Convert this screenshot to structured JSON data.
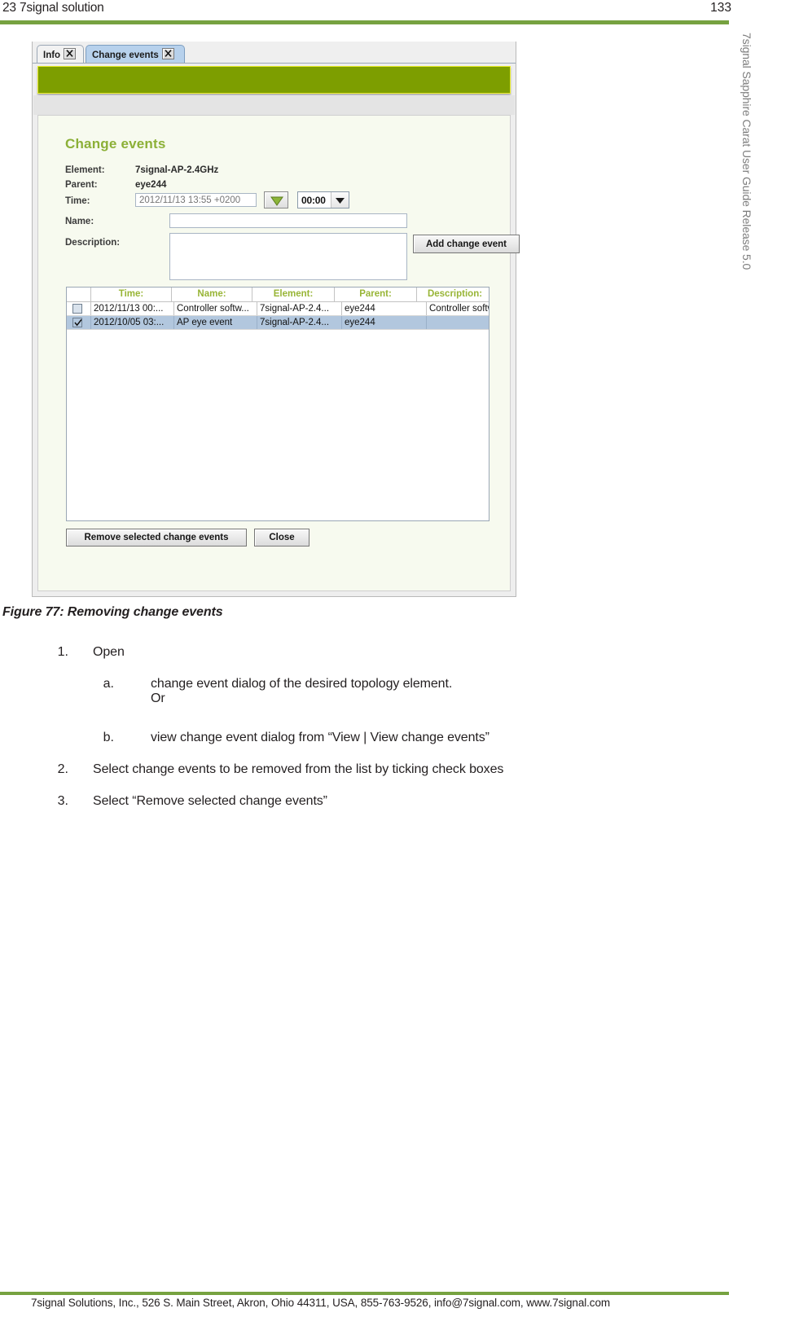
{
  "page_header": {
    "running_title": "23 7signal solution",
    "page_number": "133",
    "rule_color": "#76a240"
  },
  "side_running_title": "7signal Sapphire Carat User Guide Release 5.0",
  "figure": {
    "caption": "Figure 77: Removing change events",
    "app": {
      "tabs": [
        {
          "label": "Info",
          "close_icon": "close-icon",
          "active": false
        },
        {
          "label": "Change events",
          "close_icon": "close-icon",
          "active": true
        }
      ],
      "banner_color": "#7d9e00",
      "panel": {
        "title": "Change events",
        "fields": {
          "element_label": "Element:",
          "element_value": "7signal-AP-2.4GHz",
          "parent_label": "Parent:",
          "parent_value": "eye244",
          "time_label": "Time:",
          "time_placeholder": "2012/11/13 13:55 +0200",
          "time_value": "",
          "calendar_icon": "triangle-down-icon",
          "time_combo_value": "00:00",
          "time_combo_icon": "chevron-down-icon",
          "name_label": "Name:",
          "name_value": "",
          "description_label": "Description:",
          "description_value": ""
        },
        "add_button_label": "Add change event",
        "table": {
          "columns": [
            "",
            "Time:",
            "Name:",
            "Element:",
            "Parent:",
            "Description:"
          ],
          "rows": [
            {
              "checked": false,
              "selected": false,
              "time": "2012/11/13 00:...",
              "name": "Controller softw...",
              "element": "7signal-AP-2.4...",
              "parent": "eye244",
              "description": "Controller softw..."
            },
            {
              "checked": true,
              "selected": true,
              "time": "2012/10/05 03:...",
              "name": "AP eye event",
              "element": "7signal-AP-2.4...",
              "parent": "eye244",
              "description": ""
            }
          ]
        },
        "remove_button_label": "Remove selected change events",
        "close_button_label": "Close"
      }
    }
  },
  "procedure": {
    "step1_number": "1.",
    "step1_text": "Open",
    "sub_a_number": "a.",
    "sub_a_text": "change event dialog of the desired topology element.\nOr",
    "sub_b_number": "b.",
    "sub_b_text": "view change event dialog from “View | View change events”",
    "step2_number": "2.",
    "step2_text": "Select change events to be removed from the list by ticking check boxes",
    "step3_number": "3.",
    "step3_text": "Select “Remove selected change events”"
  },
  "footer": {
    "text": "7signal Solutions, Inc., 526 S. Main Street, Akron, Ohio 44311, USA, 855-763-9526, info@7signal.com, www.7signal.com",
    "rule_color": "#76a240"
  }
}
